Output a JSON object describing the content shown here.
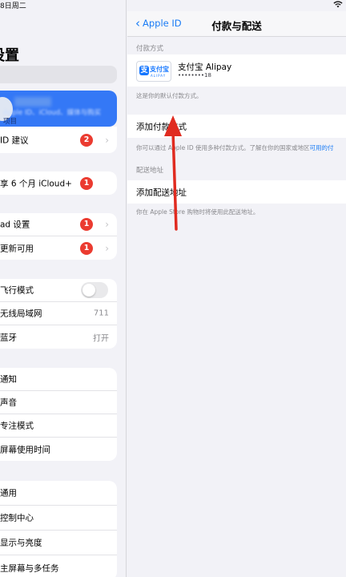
{
  "status_bar": {
    "time": "8日周二"
  },
  "sidebar": {
    "title": "设置",
    "profile": {
      "subtitle_visible": "项目",
      "subtitle_blurred": "Apple ID、iCloud、媒体与购买"
    },
    "apple_id_suggestions": {
      "label": "ID 建议",
      "badge": "2"
    },
    "icloud_offer": {
      "label": "享 6 个月 iCloud+",
      "badge": "1"
    },
    "updates": [
      {
        "label": "ad 设置",
        "badge": "1"
      },
      {
        "label": "更新可用",
        "badge": "1"
      }
    ],
    "connectivity": [
      {
        "label": "飞行模式",
        "value": ""
      },
      {
        "label": "无线局域网",
        "value": "711"
      },
      {
        "label": "蓝牙",
        "value": "打开"
      }
    ],
    "notifications": [
      {
        "label": "通知"
      },
      {
        "label": "声音"
      },
      {
        "label": "专注模式"
      },
      {
        "label": "屏幕使用时间"
      }
    ],
    "general": [
      {
        "label": "通用"
      },
      {
        "label": "控制中心"
      },
      {
        "label": "显示与亮度"
      },
      {
        "label": "主屏幕与多任务"
      }
    ]
  },
  "nav": {
    "back_label": "Apple ID",
    "title": "付款与配送"
  },
  "payment": {
    "section_header": "付款方式",
    "method_name": "支付宝 Alipay",
    "method_number": "••••••••18",
    "logo_text": "支付宝",
    "logo_subtext": "ALIPAY",
    "default_note": "这是你的默认付款方式。",
    "add_label": "添加付款方式",
    "add_note": "你可以通过 Apple ID 使用多种付款方式。了解在你的国家或地区",
    "add_note_link": "可用的付"
  },
  "shipping": {
    "section_header": "配送地址",
    "add_label": "添加配送地址",
    "note": "你在 Apple Store 购物时将使用此配送地址。"
  },
  "colors": {
    "accent": "#1a7cf5",
    "badge": "#eb3b30",
    "profile_bg": "#3478f6",
    "arrow": "#e02b20"
  }
}
